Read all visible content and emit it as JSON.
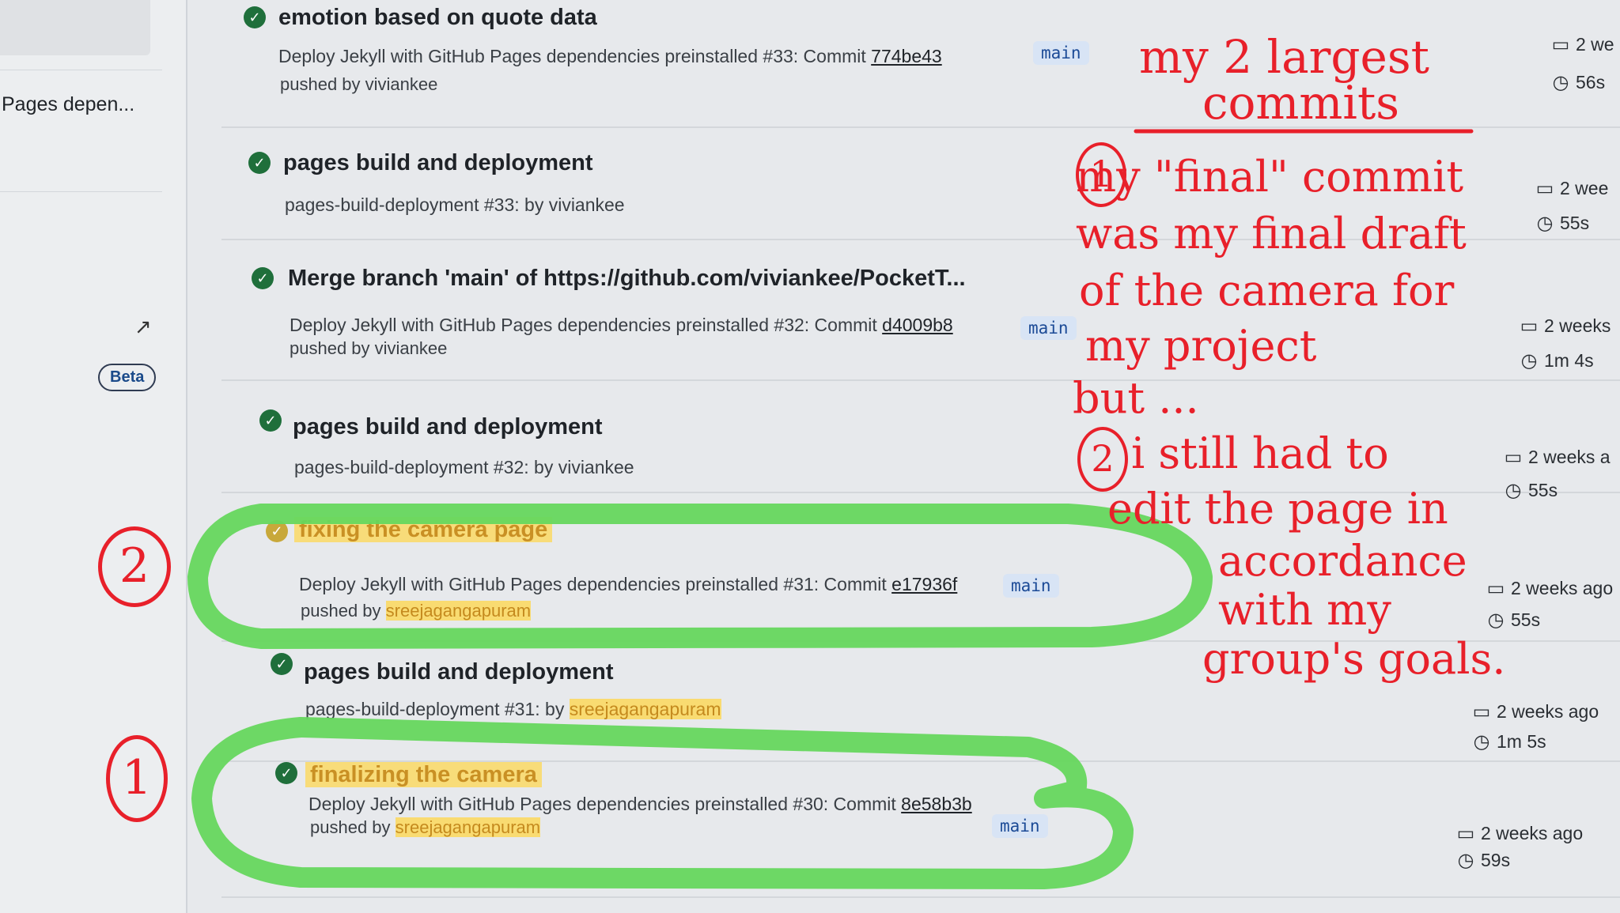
{
  "sidebar": {
    "text": "Pages depen...",
    "arrow": "↗",
    "beta": "Beta"
  },
  "runs": [
    {
      "title": "emotion based on quote data",
      "desc": "Deploy Jekyll with GitHub Pages dependencies preinstalled #33: Commit ",
      "commit": "774be43",
      "pushed_prefix": "pushed by ",
      "pushed_by": "viviankee",
      "branch": "main",
      "date": "2 we",
      "duration": "56s"
    },
    {
      "title": "pages build and deployment",
      "desc": "pages-build-deployment #33: by viviankee",
      "date": "2 wee",
      "duration": "55s"
    },
    {
      "title": "Merge branch 'main' of https://github.com/viviankee/PocketT...",
      "desc": "Deploy Jekyll with GitHub Pages dependencies preinstalled #32: Commit ",
      "commit": "d4009b8",
      "pushed_prefix": "pushed by ",
      "pushed_by": "viviankee",
      "branch": "main",
      "date": "2 weeks",
      "duration": "1m 4s"
    },
    {
      "title": "pages build and deployment",
      "desc": "pages-build-deployment #32: by viviankee",
      "date": "2 weeks a",
      "duration": "55s"
    },
    {
      "title": "fixing the camera page",
      "desc": "Deploy Jekyll with GitHub Pages dependencies preinstalled #31: Commit ",
      "commit": "e17936f",
      "pushed_prefix": "pushed by ",
      "pushed_by": "sreejagangapuram",
      "branch": "main",
      "date": "2 weeks ago",
      "duration": "55s"
    },
    {
      "title": "pages build and deployment",
      "desc_prefix": "pages-build-deployment #31: by ",
      "desc_user": "sreejagangapuram",
      "date": "2 weeks ago",
      "duration": "1m 5s"
    },
    {
      "title": "finalizing the camera",
      "desc": "Deploy Jekyll with GitHub Pages dependencies preinstalled #30: Commit ",
      "commit": "8e58b3b",
      "pushed_prefix": "pushed by ",
      "pushed_by": "sreejagangapuram",
      "branch": "main",
      "date": "2 weeks ago",
      "duration": "59s"
    }
  ],
  "annotations": {
    "heading_line1": "my 2 largest",
    "heading_line2": "commits",
    "note_lines": [
      "my \"final\" commit",
      "was my final draft",
      "of the camera for",
      "my project",
      "but ...",
      "i still had to",
      "edit the page in",
      "accordance",
      "with my",
      "group's goals."
    ],
    "circle_1": "1",
    "circle_2": "2",
    "colors": {
      "ink": "#e8202a",
      "marker_green": "#66d75e",
      "highlighter": "#ffd648"
    }
  },
  "icons": {
    "status": "check-circle-icon",
    "date": "calendar-icon",
    "duration": "stopwatch-icon"
  }
}
